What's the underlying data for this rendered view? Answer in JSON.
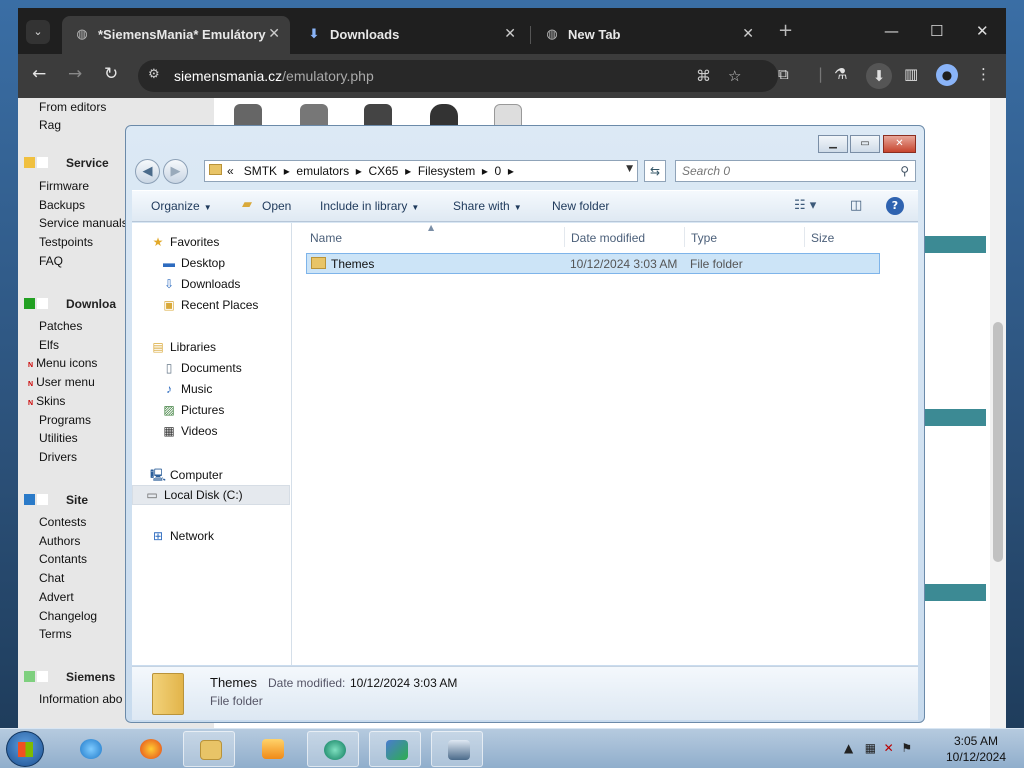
{
  "browser": {
    "tabs": [
      {
        "label": "*SiemensMania* Emulátory",
        "icon": "globe-icon",
        "active": true
      },
      {
        "label": "Downloads",
        "icon": "download-icon",
        "active": false
      },
      {
        "label": "New Tab",
        "icon": "globe-icon",
        "active": false
      }
    ],
    "url_host": "siemensmania.cz",
    "url_path": "/emulatory.php"
  },
  "website": {
    "sidebar_top": [
      "From editors",
      "Rag"
    ],
    "sections": [
      {
        "title": "Service",
        "color": "#f0c040",
        "items": [
          {
            "label": "Firmware",
            "new": false
          },
          {
            "label": "Backups",
            "new": false
          },
          {
            "label": "Service manuals",
            "new": false
          },
          {
            "label": "Testpoints",
            "new": false
          },
          {
            "label": "FAQ",
            "new": false
          }
        ]
      },
      {
        "title": "Downloa",
        "color": "#22a022",
        "items": [
          {
            "label": "Patches",
            "new": false
          },
          {
            "label": "Elfs",
            "new": false
          },
          {
            "label": "Menu icons",
            "new": true
          },
          {
            "label": "User menu",
            "new": true
          },
          {
            "label": "Skins",
            "new": true
          },
          {
            "label": "Programs",
            "new": false
          },
          {
            "label": "Utilities",
            "new": false
          },
          {
            "label": "Drivers",
            "new": false
          }
        ]
      },
      {
        "title": "Site",
        "color": "#2a7ac8",
        "items": [
          {
            "label": "Contests",
            "new": false
          },
          {
            "label": "Authors",
            "new": false
          },
          {
            "label": "Contants",
            "new": false
          },
          {
            "label": "Chat",
            "new": false
          },
          {
            "label": "Advert",
            "new": false
          },
          {
            "label": "Changelog",
            "new": false
          },
          {
            "label": "Terms",
            "new": false
          }
        ]
      },
      {
        "title": "Siemens",
        "color": "#7fd07f",
        "items": [
          {
            "label": "Information abo",
            "new": false
          }
        ]
      }
    ],
    "new_badge": "N"
  },
  "explorer": {
    "breadcrumb_prefix": "«",
    "breadcrumb": [
      "SMTK",
      "emulators",
      "CX65",
      "Filesystem",
      "0"
    ],
    "search_placeholder": "Search 0",
    "commands": {
      "organize": "Organize",
      "open": "Open",
      "include": "Include in library",
      "share": "Share with",
      "newfolder": "New folder"
    },
    "nav": {
      "favorites": "Favorites",
      "fav_items": [
        "Desktop",
        "Downloads",
        "Recent Places"
      ],
      "libraries": "Libraries",
      "lib_items": [
        "Documents",
        "Music",
        "Pictures",
        "Videos"
      ],
      "computer": "Computer",
      "comp_items": [
        "Local Disk (C:)"
      ],
      "network": "Network"
    },
    "columns": {
      "name": "Name",
      "date": "Date modified",
      "type": "Type",
      "size": "Size"
    },
    "files": [
      {
        "name": "Themes",
        "date": "10/12/2024 3:03 AM",
        "type": "File folder"
      }
    ],
    "details": {
      "name": "Themes",
      "date_label": "Date modified:",
      "date": "10/12/2024 3:03 AM",
      "type": "File folder"
    }
  },
  "taskbar": {
    "time": "3:05 AM",
    "date": "10/12/2024"
  }
}
